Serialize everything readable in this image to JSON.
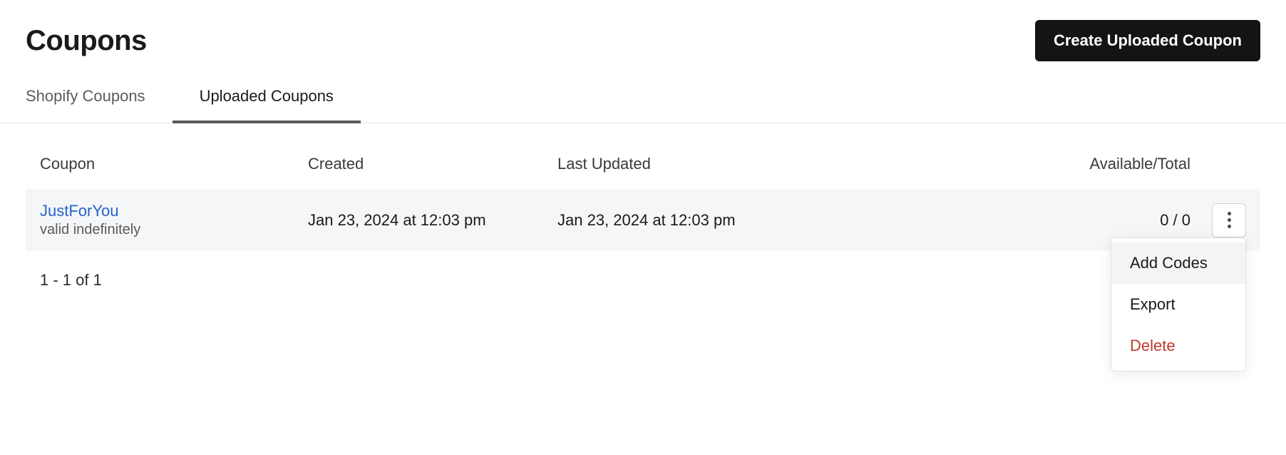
{
  "header": {
    "title": "Coupons",
    "create_button": "Create Uploaded Coupon"
  },
  "tabs": {
    "shopify": "Shopify Coupons",
    "uploaded": "Uploaded Coupons"
  },
  "table": {
    "headers": {
      "coupon": "Coupon",
      "created": "Created",
      "updated": "Last Updated",
      "available": "Available/Total"
    },
    "row": {
      "name": "JustForYou",
      "validity": "valid indefinitely",
      "created": "Jan 23, 2024 at 12:03 pm",
      "updated": "Jan 23, 2024 at 12:03 pm",
      "available": "0 / 0"
    }
  },
  "menu": {
    "add_codes": "Add Codes",
    "export": "Export",
    "delete": "Delete"
  },
  "pagination": "1 - 1 of 1"
}
